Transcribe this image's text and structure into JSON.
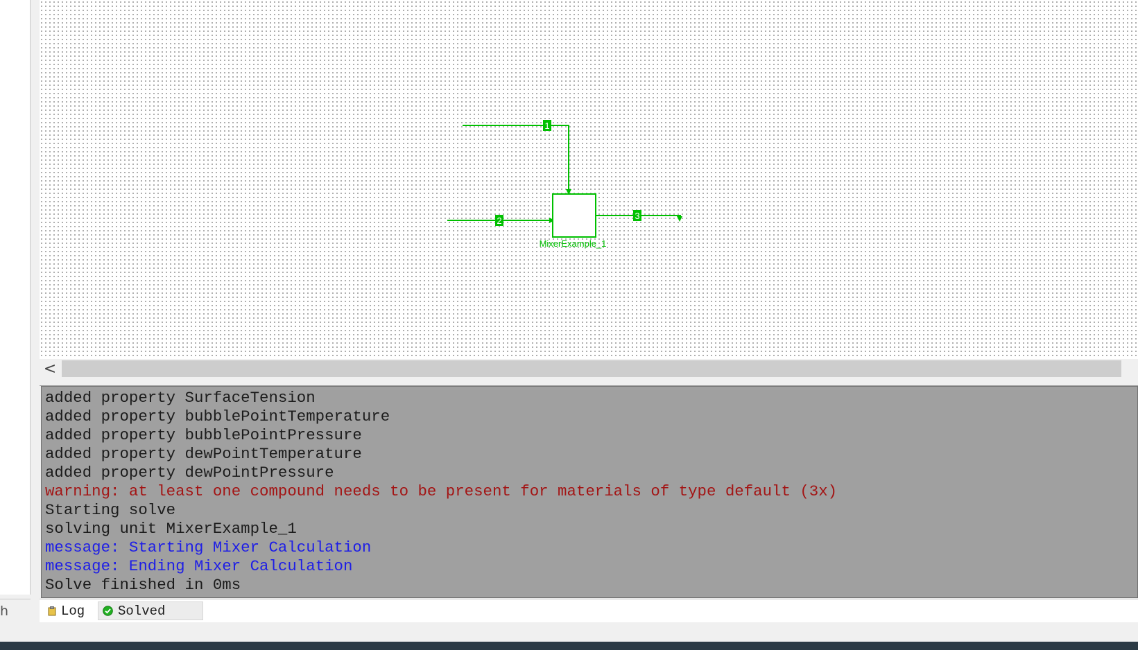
{
  "flowsheet": {
    "accent_color": "#00c000",
    "unit_label": "MixerExample_1",
    "streams": [
      {
        "label": "1"
      },
      {
        "label": "2"
      },
      {
        "label": "3"
      }
    ]
  },
  "scrollbar": {
    "left_arrow": "<"
  },
  "left_pane": {
    "clipped_text": "h"
  },
  "log": {
    "lines": [
      {
        "text": "added property SurfaceTension",
        "kind": "normal"
      },
      {
        "text": "added property bubblePointTemperature",
        "kind": "normal"
      },
      {
        "text": "added property bubblePointPressure",
        "kind": "normal"
      },
      {
        "text": "added property dewPointTemperature",
        "kind": "normal"
      },
      {
        "text": "added property dewPointPressure",
        "kind": "normal"
      },
      {
        "text": "warning: at least one compound needs to be present for materials of type default (3x)",
        "kind": "warning"
      },
      {
        "text": "Starting solve",
        "kind": "normal"
      },
      {
        "text": "solving unit MixerExample_1",
        "kind": "normal"
      },
      {
        "text": "message: Starting Mixer Calculation",
        "kind": "message"
      },
      {
        "text": "message: Ending Mixer Calculation",
        "kind": "message"
      },
      {
        "text": "Solve finished in 0ms",
        "kind": "normal"
      }
    ],
    "colors": {
      "normal": "#1c1c1c",
      "warning": "#a31515",
      "message": "#1e1ee6"
    }
  },
  "tabs": {
    "log_label": "Log",
    "log_icon": "clipboard-icon",
    "solved_label": "Solved",
    "solved_icon": "check-circle-icon"
  }
}
